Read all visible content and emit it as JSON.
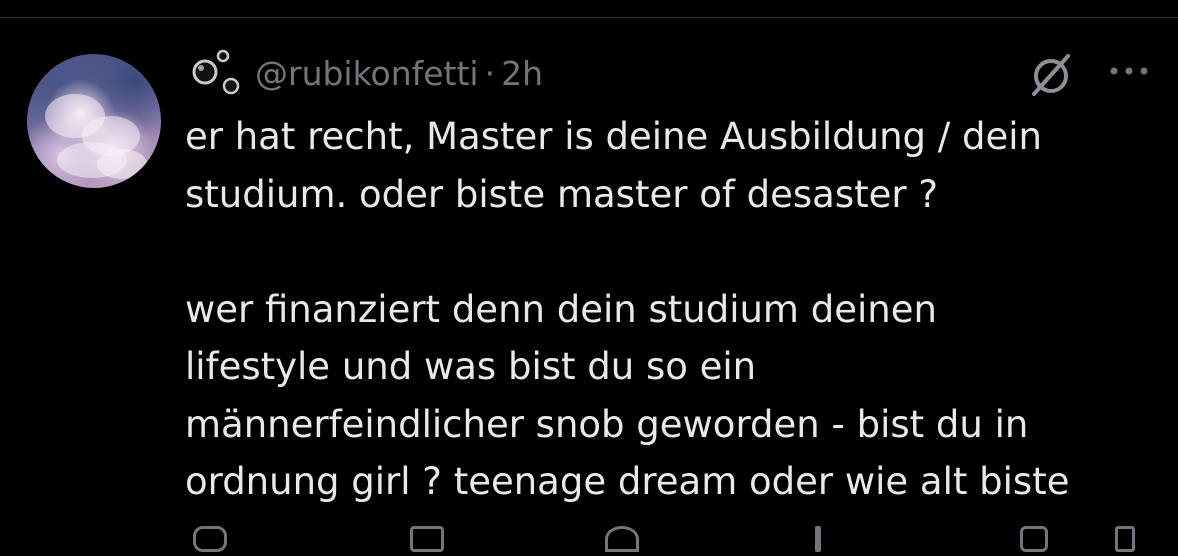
{
  "tweet": {
    "handle": "@rubikonfetti",
    "separator": "·",
    "time": "2h",
    "lines": [
      "er hat recht, Master is deine Ausbildung / dein",
      "studium. oder biste master of desaster ?",
      "",
      "wer finanziert denn dein studium deinen",
      "lifestyle und was bist du so ein",
      "männerfeindlicher snob geworden - bist du in",
      "ordnung girl ? teenage dream oder wie alt biste"
    ]
  },
  "icons": {
    "badge": "bubbles-icon",
    "grok": "grok-icon",
    "more": "more-options-icon"
  },
  "colors": {
    "background": "#000000",
    "text": "#e7e9ea",
    "muted": "#71767b"
  }
}
